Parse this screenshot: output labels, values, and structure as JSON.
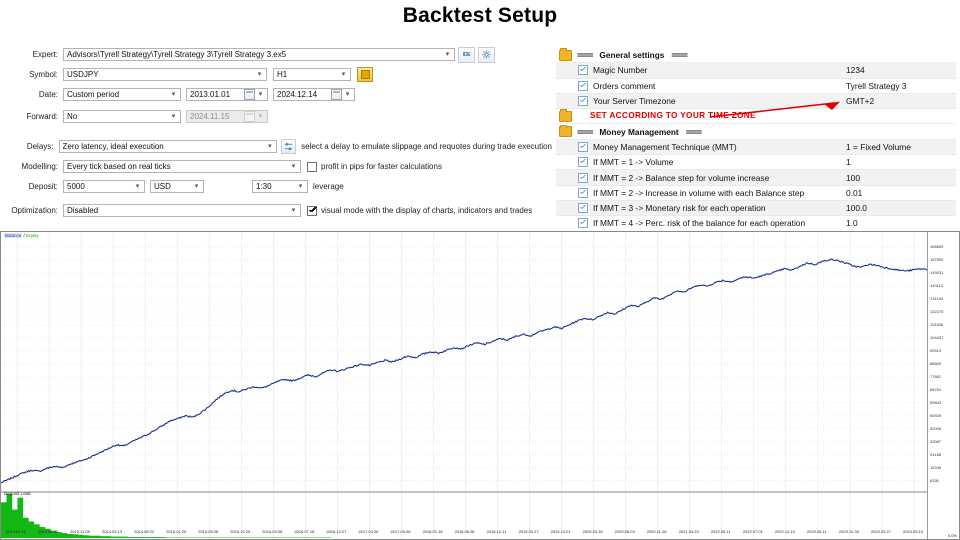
{
  "title": "Backtest Setup",
  "form": {
    "expert": {
      "label": "Expert:",
      "value": "Advisors\\Tyrell Strategy\\Tyrell Strategy 3\\Tyrell Strategy 3.ex5",
      "ide_button": "IDE",
      "settings_icon": "gear-icon"
    },
    "symbol": {
      "label": "Symbol:",
      "value": "USDJPY",
      "timeframe": "H1"
    },
    "date": {
      "label": "Date:",
      "mode": "Custom period",
      "from": "2013.01.01",
      "to": "2024.12.14"
    },
    "forward": {
      "label": "Forward:",
      "mode": "No",
      "date": "2024.11.15"
    },
    "delays": {
      "label": "Delays:",
      "value": "Zero latency, ideal execution",
      "hint": "select a delay to emulate slippage and requotes during trade execution"
    },
    "modelling": {
      "label": "Modelling:",
      "value": "Every tick based on real ticks",
      "checkbox_label": "profit in pips for faster calculations",
      "checked": false
    },
    "deposit": {
      "label": "Deposit:",
      "amount": "5000",
      "currency": "USD",
      "leverage": "1:30",
      "leverage_label": "leverage"
    },
    "optimization": {
      "label": "Optimization:",
      "value": "Disabled",
      "checkbox_label": "visual mode with the display of charts, indicators and trades",
      "checked": true
    }
  },
  "inputs": {
    "groups": [
      {
        "name": "General settings",
        "sep": "===="
      },
      {
        "name": "Money Management",
        "sep": "===="
      }
    ],
    "general_rows": [
      {
        "name": "Magic Number",
        "value": "1234"
      },
      {
        "name": "Orders comment",
        "value": "Tyrell Strategy 3"
      },
      {
        "name": "Your Server Timezone",
        "value": "GMT+2"
      }
    ],
    "mm_rows": [
      {
        "name": "Money Management Technique (MMT)",
        "value": "1 = Fixed Volume"
      },
      {
        "name": "If MMT = 1 -> Volume",
        "value": "1"
      },
      {
        "name": "If MMT = 2 -> Balance step for volume increase",
        "value": "100"
      },
      {
        "name": "If MMT = 2 -> Increase in volume with each Balance step",
        "value": "0.01"
      },
      {
        "name": "If MMT = 3 -> Monetary risk for each operation",
        "value": "100.0"
      },
      {
        "name": "If MMT = 4 -> Perc. risk of the balance for each operation",
        "value": "1.0"
      }
    ],
    "annotation": "SET ACCORDING TO YOUR TIME ZONE",
    "annotation_color": "#e00000"
  },
  "chart_data": {
    "type": "line",
    "title": "",
    "legend": [
      "Balance",
      "Equity"
    ],
    "legend_separator": "/",
    "secondary_panel_label": "Deposit Load",
    "xlabel": "",
    "ylabel": "",
    "ylim": [
      0,
      166869
    ],
    "y_ticks": [
      166869,
      157950,
      149031,
      140113,
      131194,
      122275,
      113356,
      104437,
      95519,
      86600,
      77681,
      68762,
      59843,
      50925,
      42006,
      33087,
      24168,
      15249,
      6330
    ],
    "zero_label": "0.0%",
    "x_ticks": [
      "2013.01.11",
      "2013.06.20",
      "2013.11.09",
      "2014.03.13",
      "2014.08.22",
      "2015.01.20",
      "2015.05.06",
      "2015.10.29",
      "2016.03.08",
      "2016.07.18",
      "2016.12.27",
      "2017.04.20",
      "2017.09.06",
      "2018.01.18",
      "2018.06.06",
      "2018.10.11",
      "2019.03.27",
      "2019.10.01",
      "2020.03.18",
      "2020.08.03",
      "2020.11.26",
      "2021.04.23",
      "2022.05.11",
      "2022.07.01",
      "2022.12.19",
      "2023.05.11",
      "2023.10.30",
      "2024.03.27",
      "2024.09.10"
    ],
    "series": [
      {
        "name": "Balance",
        "color": "#1f2f8c",
        "values": [
          5000,
          7200,
          9800,
          12000,
          13500,
          12800,
          15000,
          16200,
          15400,
          17800,
          19500,
          21000,
          23500,
          26000,
          28500,
          31000,
          30200,
          33000,
          35500,
          38000,
          41000,
          44000,
          47500,
          49000,
          51000,
          50000,
          53000,
          57000,
          62000,
          66000,
          68500,
          67500,
          69500,
          71000,
          70000,
          72000,
          74500,
          76000,
          75000,
          77000,
          79000,
          78000,
          80500,
          82500,
          81500,
          83500,
          85000,
          86500,
          85500,
          87500,
          89000,
          88000,
          90000,
          92000,
          91000,
          93500,
          95000,
          94000,
          96000,
          98000,
          97000,
          99500,
          101000,
          100000,
          102000,
          104000,
          103000,
          105500,
          107000,
          106000,
          108500,
          110000,
          112000,
          111000,
          113500,
          116000,
          118000,
          117000,
          119500,
          122000,
          121000,
          124000,
          127000,
          126000,
          129000,
          132000,
          131000,
          134000,
          137000,
          136000,
          139000,
          141000,
          140000,
          142500,
          144000,
          143000,
          145000,
          146500,
          145500,
          147000,
          148500,
          150000,
          152000,
          151000,
          153500,
          156000,
          155000,
          157000,
          158500,
          157500,
          156000,
          154000,
          153000,
          155000,
          154500,
          153000,
          152000,
          151000,
          150500,
          151500,
          152000,
          151000
        ]
      },
      {
        "name": "Equity",
        "color": "#19a319",
        "values": []
      }
    ],
    "deposit_load": {
      "color": "#14b814",
      "label": "Deposit Load",
      "values": [
        78,
        96,
        62,
        88,
        44,
        36,
        30,
        24,
        20,
        16,
        13,
        11,
        9,
        8,
        7,
        6,
        5,
        5,
        4,
        4,
        3,
        3,
        3,
        2,
        2,
        2,
        2,
        2,
        2,
        2,
        1,
        1,
        1,
        1,
        1,
        1,
        1,
        1,
        1,
        1,
        1,
        1,
        1,
        1,
        1,
        1,
        1,
        1,
        1,
        1,
        1,
        1,
        1,
        1,
        1,
        1,
        1,
        1,
        1,
        1
      ]
    },
    "grid": true,
    "legend_position": "top-left"
  }
}
